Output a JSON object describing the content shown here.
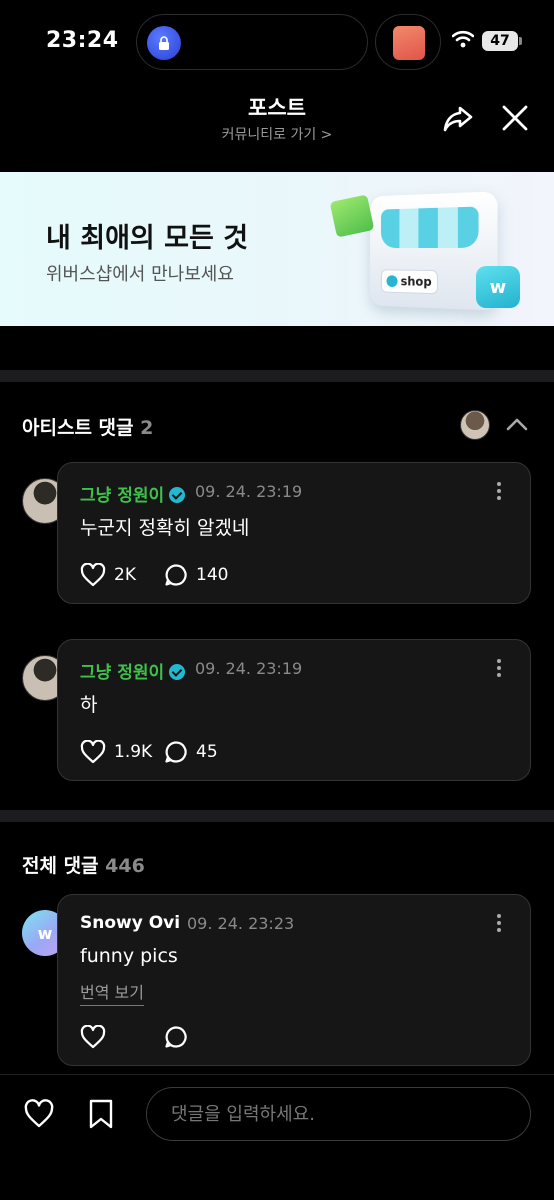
{
  "status_bar": {
    "time": "23:24",
    "battery": "47"
  },
  "header": {
    "title": "포스트",
    "subtitle": "커뮤니티로 가기 >"
  },
  "banner": {
    "title": "내 최애의 모든 것",
    "subtitle": "위버스샵에서 만나보세요",
    "shop_label": "shop"
  },
  "artist_section": {
    "title": "아티스트 댓글",
    "count": "2"
  },
  "artist_comments": [
    {
      "author": "그냥 정원이",
      "time": "09. 24. 23:19",
      "text": "누군지 정확히 알겠네",
      "likes": "2K",
      "replies": "140"
    },
    {
      "author": "그냥 정원이",
      "time": "09. 24. 23:19",
      "text": "하",
      "likes": "1.9K",
      "replies": "45"
    }
  ],
  "all_section": {
    "title": "전체 댓글",
    "count": "446"
  },
  "all_comments": [
    {
      "author": "Snowy Ovi",
      "time": "09. 24. 23:23",
      "text": "funny pics",
      "translate": "번역 보기"
    }
  ],
  "comment_input": {
    "placeholder": "댓글을 입력하세요."
  },
  "colors": {
    "artist_name": "#3ec24b",
    "verified": "#23b8cf",
    "background": "#000000"
  },
  "icons": [
    "lock-icon",
    "wifi-icon",
    "share-icon",
    "close-icon",
    "chevron-up-icon",
    "more-vertical-icon",
    "heart-icon",
    "comment-bubble-icon",
    "bookmark-icon",
    "verified-badge-icon"
  ]
}
